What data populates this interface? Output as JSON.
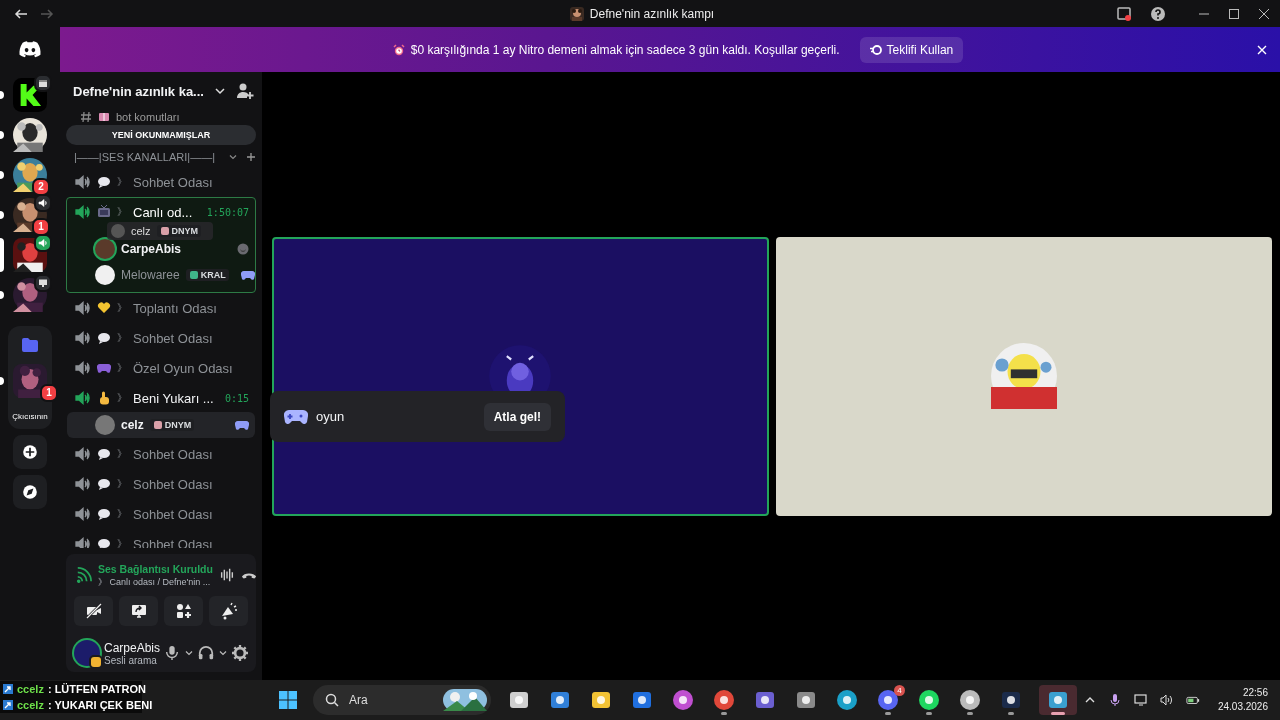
{
  "title_bar": {
    "title": "Defne'nin azınlık kampı"
  },
  "banner": {
    "text": "$0 karşılığında 1 ay Nitro demeni almak için sadece 3 gün kaldı. Koşullar geçerli.",
    "button": "Teklifi Kullan"
  },
  "servers": [
    {
      "kind": "k",
      "unread": true,
      "selected": false
    },
    {
      "kind": "picture",
      "unread": true,
      "selected": false
    },
    {
      "kind": "picture",
      "unread": true,
      "selected": false,
      "badge": "2"
    },
    {
      "kind": "picture",
      "unread": true,
      "selected": false,
      "badge": "1"
    },
    {
      "kind": "picture",
      "unread": false,
      "selected": true
    },
    {
      "kind": "picture",
      "unread": true,
      "selected": false
    },
    {
      "kind": "folder",
      "unread": false,
      "selected": false,
      "children": [
        {
          "kind": "picture",
          "unread": true,
          "selected": false,
          "badge": "1"
        },
        {
          "kind": "label",
          "unread": false,
          "selected": false,
          "label": "Çkıcısının"
        }
      ]
    },
    {
      "kind": "add",
      "unread": false,
      "selected": false
    },
    {
      "kind": "discover",
      "unread": false,
      "selected": false
    }
  ],
  "channel_header": {
    "name": "Defne'nin azınlık ka..."
  },
  "text_channel": {
    "name": "bot komutları"
  },
  "unread_pill": "YENİ OKUNMAMIŞLAR",
  "category": {
    "name": "|——|SES KANALLARI|——|"
  },
  "voice_channels": [
    {
      "separator": "》",
      "name": "Sohbet Odası",
      "live": false,
      "selected": false
    },
    {
      "separator": "》",
      "name": "Canlı od...",
      "live": true,
      "selected": true,
      "timer": "1:50:07",
      "members": [
        {
          "name": "CarpeAbis",
          "speaking": true,
          "selected": false
        },
        {
          "name": "Melowaree",
          "speaking": false,
          "selected": false,
          "tag": "KRAL"
        }
      ]
    },
    {
      "separator": "》",
      "name": "Toplantı Odası",
      "live": false,
      "selected": false
    },
    {
      "separator": "》",
      "name": "Sohbet Odası",
      "live": false,
      "selected": false
    },
    {
      "separator": "》",
      "name": "Özel Oyun Odası",
      "live": false,
      "selected": false
    },
    {
      "separator": "》",
      "name": "Beni Yukarı ...",
      "live": true,
      "selected": false,
      "timer": "0:15",
      "members": [
        {
          "name": "celz",
          "speaking": false,
          "selected": true,
          "tag": "DNYM"
        }
      ]
    },
    {
      "separator": "》",
      "name": "Sohbet Odası",
      "live": false,
      "selected": false
    },
    {
      "separator": "》",
      "name": "Sohbet Odası",
      "live": false,
      "selected": false
    },
    {
      "separator": "》",
      "name": "Sohbet Odası",
      "live": false,
      "selected": false
    },
    {
      "separator": "》",
      "name": "Sohbet Odası",
      "live": false,
      "selected": false
    }
  ],
  "drag_ghost": {
    "name": "celz",
    "tag": "DNYM"
  },
  "voice_panel": {
    "status": "Ses Bağlantısı Kuruldu",
    "location": "》 Canlı odası / Defne'nin ..."
  },
  "user_panel": {
    "name": "CarpeAbis",
    "status": "Sesli arama"
  },
  "tiles": [
    {
      "kind": "video",
      "speaking": true,
      "color": "#1b0f62"
    },
    {
      "kind": "avatar",
      "speaking": false,
      "color": "#d9d8ca"
    }
  ],
  "activity_popup": {
    "name": "oyun",
    "button": "Atla gel!"
  },
  "taskbar": {
    "search": "Ara",
    "apps": [
      {
        "kind": "taskview",
        "running": false,
        "selected": false
      },
      {
        "kind": "store",
        "running": false,
        "selected": false
      },
      {
        "kind": "explorer",
        "running": false,
        "selected": false
      },
      {
        "kind": "bluebox",
        "running": false,
        "selected": false
      },
      {
        "kind": "copilot",
        "running": false,
        "selected": false
      },
      {
        "kind": "chrome",
        "running": true,
        "selected": false
      },
      {
        "kind": "teams",
        "running": false,
        "selected": false
      },
      {
        "kind": "hex",
        "running": false,
        "selected": false
      },
      {
        "kind": "edge",
        "running": false,
        "selected": false
      },
      {
        "kind": "discord",
        "running": true,
        "selected": false,
        "badge": "4"
      },
      {
        "kind": "spotify",
        "running": true,
        "selected": false
      },
      {
        "kind": "obs",
        "running": true,
        "selected": false
      },
      {
        "kind": "steam",
        "running": true,
        "selected": false
      },
      {
        "kind": "window",
        "running": true,
        "selected": true
      }
    ],
    "time": "22:56",
    "date": "24.03.2026"
  },
  "chat_overlay": [
    {
      "user": "ccelz",
      "text": ": LÜTFEN PATRON"
    },
    {
      "user": "ccelz",
      "text": ": YUKARI ÇEK BENI"
    }
  ]
}
